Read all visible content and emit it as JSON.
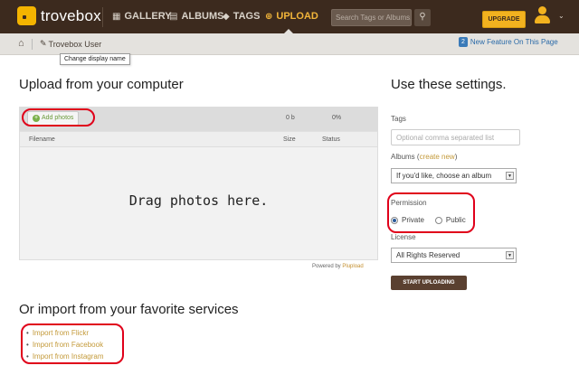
{
  "header": {
    "logo_text": "trovebox",
    "nav": {
      "gallery": "GALLERY",
      "albums": "ALBUMS",
      "tags": "TAGS",
      "upload": "UPLOAD"
    },
    "search_placeholder": "Search Tags or Albums...",
    "upgrade_label": "UPGRADE",
    "active_color": "#f2b53a"
  },
  "breadcrumb": {
    "user": "Trovebox User",
    "tooltip": "Change display name",
    "feature_count": "2",
    "feature_text": "New Feature On This Page"
  },
  "upload": {
    "title": "Upload from your computer",
    "add_photos": "Add photos",
    "total_size": "0 b",
    "percent": "0%",
    "columns": {
      "filename": "Filename",
      "size": "Size",
      "status": "Status"
    },
    "drop_text": "Drag photos here.",
    "powered_prefix": "Powered by",
    "powered_link": "Plupload"
  },
  "import": {
    "title": "Or import from your favorite services",
    "items": [
      "Import from Flickr",
      "Import from Facebook",
      "Import from Instagram"
    ]
  },
  "settings": {
    "title": "Use these settings.",
    "tags_label": "Tags",
    "tags_placeholder": "Optional comma separated list",
    "albums_label": "Albums",
    "albums_create": "create new",
    "albums_select": "If you'd like, choose an album",
    "permission_label": "Permission",
    "permission_private": "Private",
    "permission_public": "Public",
    "permission_selected": "Private",
    "license_label": "License",
    "license_select": "All Rights Reserved",
    "start_button": "START UPLOADING"
  },
  "colors": {
    "topbar": "#3c2a1e",
    "accent": "#f2b21f",
    "link": "#c49a3a",
    "annotation": "#e0001a"
  }
}
